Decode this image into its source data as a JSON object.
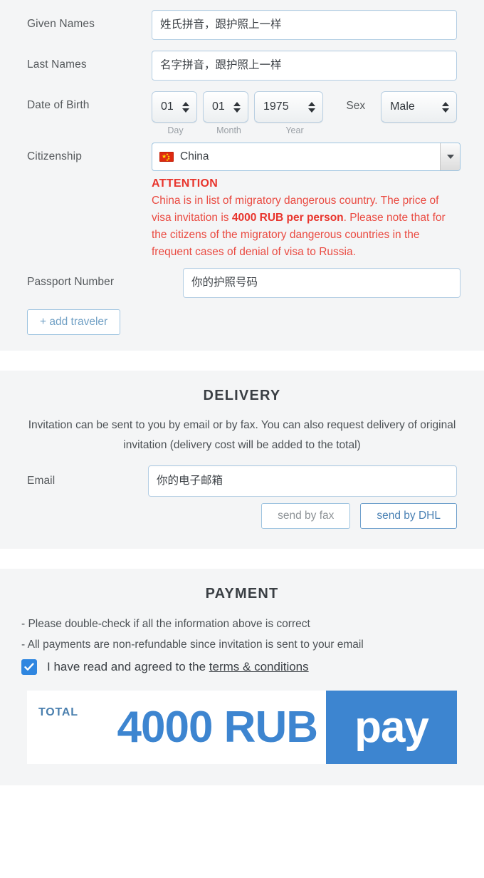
{
  "travelers": {
    "given_names": {
      "label": "Given Names",
      "placeholder": "姓氏拼音，跟护照上一样"
    },
    "last_names": {
      "label": "Last Names",
      "placeholder": "名字拼音，跟护照上一样"
    },
    "date_of_birth": {
      "label": "Date of Birth",
      "day": {
        "value": "01",
        "caption": "Day"
      },
      "month": {
        "value": "01",
        "caption": "Month"
      },
      "year": {
        "value": "1975",
        "caption": "Year"
      }
    },
    "sex": {
      "label": "Sex",
      "value": "Male"
    },
    "citizenship": {
      "label": "Citizenship",
      "value": "China",
      "flag": "china-flag-icon",
      "dropdown_icon": "chevron-down-icon"
    },
    "attention": {
      "title": "ATTENTION",
      "line1": "China is in list of migratory dangerous country. The price of visa invitation is ",
      "highlight": "4000 RUB per person",
      "line2": ". Please note that for the citizens of the migratory dangerous countries in the frequent cases of denial of visa to Russia."
    },
    "passport": {
      "label": "Passport Number",
      "placeholder": "你的护照号码"
    },
    "add_traveler_label": "+ add traveler"
  },
  "delivery": {
    "title": "DELIVERY",
    "subtitle": "Invitation can be sent to you by email or by fax. You can also request delivery of original invitation (delivery cost will be added to the total)",
    "email": {
      "label": "Email",
      "placeholder": "你的电子邮箱"
    },
    "send_by_fax_label": "send by fax",
    "send_by_dhl_label": "send by DHL"
  },
  "payment": {
    "title": "PAYMENT",
    "note1": "- Please double-check if all the information above is correct",
    "note2": "- All payments are non-refundable since invitation is sent to your email",
    "agree_text": "I have read and agreed to the ",
    "terms_link": "terms & conditions",
    "checkbox_icon": "checkmark-icon",
    "checkbox_checked": "true",
    "total_label": "TOTAL",
    "total_amount": "4000 RUB",
    "pay_button_label": "pay"
  },
  "colors": {
    "panel_bg": "#f4f5f6",
    "accent_blue": "#3d85d0",
    "attention_red": "#e8342c",
    "input_border": "#b5cfe4",
    "label_text": "#55595c"
  }
}
